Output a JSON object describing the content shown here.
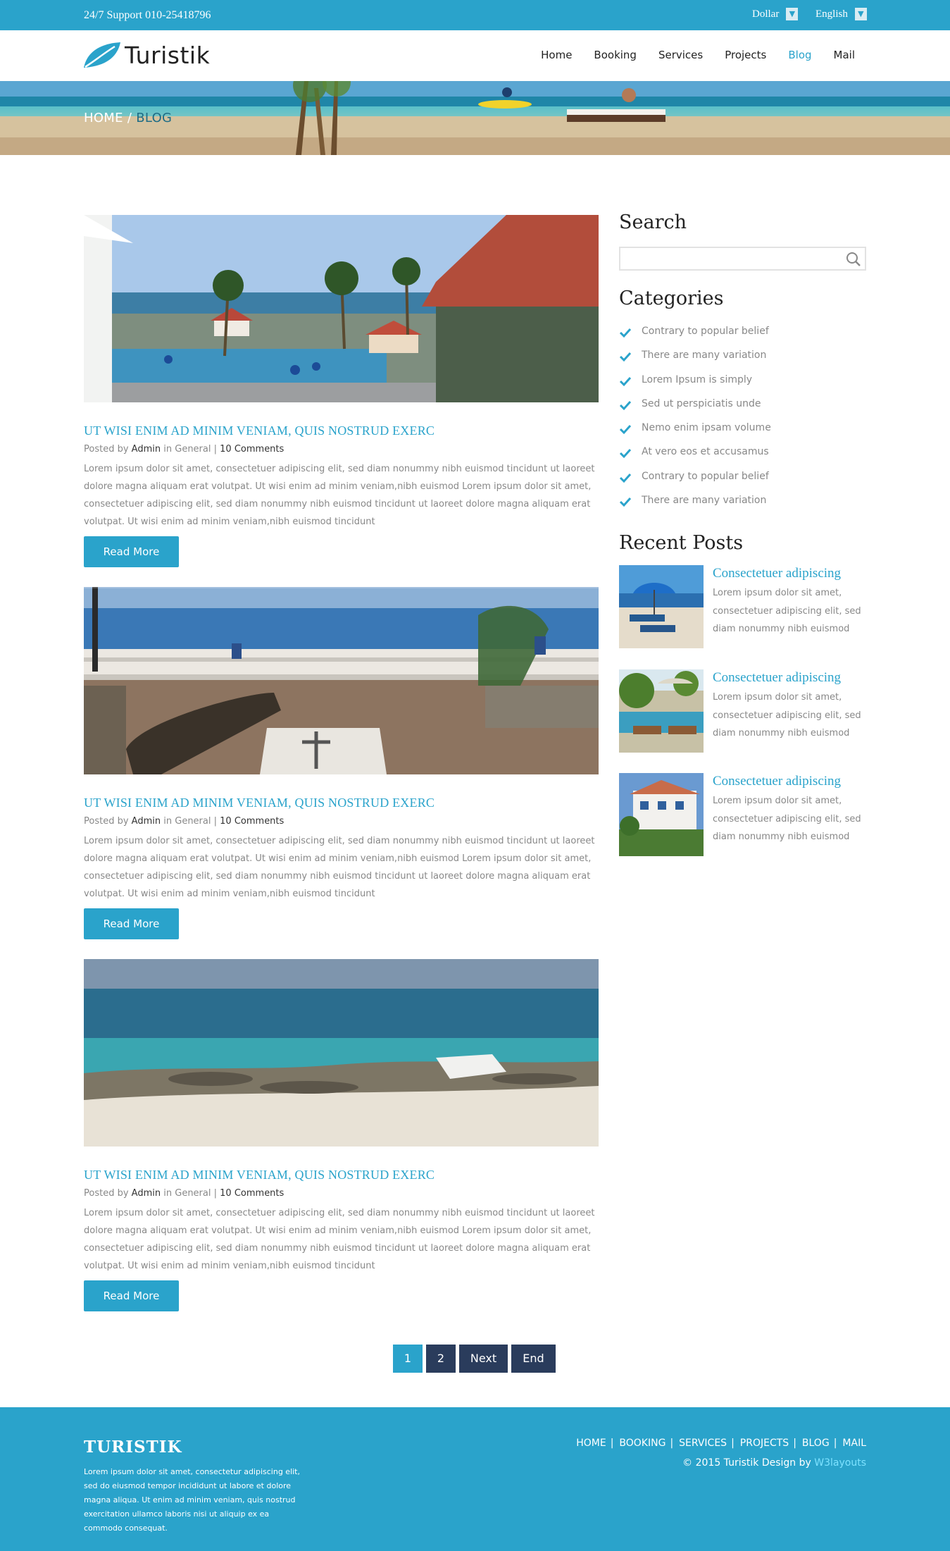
{
  "topbar": {
    "support": "24/7 Support 010-25418796",
    "currency": "Dollar",
    "language": "English"
  },
  "header": {
    "brand": "Turistik",
    "nav": [
      {
        "label": "Home"
      },
      {
        "label": "Booking"
      },
      {
        "label": "Services"
      },
      {
        "label": "Projects"
      },
      {
        "label": "Blog",
        "active": true
      },
      {
        "label": "Mail"
      }
    ]
  },
  "breadcrumb": {
    "home": "HOME",
    "separator": " / ",
    "current": "BLOG"
  },
  "posts": [
    {
      "title": "UT WISI ENIM AD MINIM VENIAM, QUIS NOSTRUD EXERC",
      "posted_by": "Posted by",
      "author": "Admin",
      "in_text": "in",
      "category": "General",
      "divider": "|",
      "comments": "10 Comments",
      "body": "Lorem ipsum dolor sit amet, consectetuer adipiscing elit, sed diam nonummy nibh euismod tincidunt ut laoreet dolore magna aliquam erat volutpat. Ut wisi enim ad minim veniam,nibh euismod Lorem ipsum dolor sit amet, consectetuer adipiscing elit, sed diam nonummy nibh euismod tincidunt ut laoreet dolore magna aliquam erat volutpat. Ut wisi enim ad minim veniam,nibh euismod tincidunt",
      "button": "Read More"
    },
    {
      "title": "UT WISI ENIM AD MINIM VENIAM, QUIS NOSTRUD EXERC",
      "posted_by": "Posted by",
      "author": "Admin",
      "in_text": "in",
      "category": "General",
      "divider": "|",
      "comments": "10 Comments",
      "body": "Lorem ipsum dolor sit amet, consectetuer adipiscing elit, sed diam nonummy nibh euismod tincidunt ut laoreet dolore magna aliquam erat volutpat. Ut wisi enim ad minim veniam,nibh euismod Lorem ipsum dolor sit amet, consectetuer adipiscing elit, sed diam nonummy nibh euismod tincidunt ut laoreet dolore magna aliquam erat volutpat. Ut wisi enim ad minim veniam,nibh euismod tincidunt",
      "button": "Read More"
    },
    {
      "title": "UT WISI ENIM AD MINIM VENIAM, QUIS NOSTRUD EXERC",
      "posted_by": "Posted by",
      "author": "Admin",
      "in_text": "in",
      "category": "General",
      "divider": "|",
      "comments": "10 Comments",
      "body": "Lorem ipsum dolor sit amet, consectetuer adipiscing elit, sed diam nonummy nibh euismod tincidunt ut laoreet dolore magna aliquam erat volutpat. Ut wisi enim ad minim veniam,nibh euismod Lorem ipsum dolor sit amet, consectetuer adipiscing elit, sed diam nonummy nibh euismod tincidunt ut laoreet dolore magna aliquam erat volutpat. Ut wisi enim ad minim veniam,nibh euismod tincidunt",
      "button": "Read More"
    }
  ],
  "sidebar": {
    "search_title": "Search",
    "search_value": "",
    "categories_title": "Categories",
    "categories": [
      "Contrary to popular belief",
      "There are many variation",
      "Lorem Ipsum is simply",
      "Sed ut perspiciatis unde",
      "Nemo enim ipsam volume",
      "At vero eos et accusamus",
      "Contrary to popular belief",
      "There are many variation"
    ],
    "recent_title": "Recent Posts",
    "recent": [
      {
        "title": "Consectetuer adipiscing",
        "text": "Lorem ipsum dolor sit amet, consectetuer adipiscing elit, sed diam nonummy nibh euismod"
      },
      {
        "title": "Consectetuer adipiscing",
        "text": "Lorem ipsum dolor sit amet, consectetuer adipiscing elit, sed diam nonummy nibh euismod"
      },
      {
        "title": "Consectetuer adipiscing",
        "text": "Lorem ipsum dolor sit amet, consectetuer adipiscing elit, sed diam nonummy nibh euismod"
      }
    ]
  },
  "pagination": {
    "pages": [
      "1",
      "2"
    ],
    "current": "1",
    "next": "Next",
    "end": "End"
  },
  "footer": {
    "title": "TURISTIK",
    "text": "Lorem ipsum dolor sit amet, consectetur adipiscing elit, sed do eiusmod tempor incididunt ut labore et dolore magna aliqua. Ut enim ad minim veniam, quis nostrud exercitation ullamco laboris nisi ut aliquip ex ea commodo consequat.",
    "nav": [
      "HOME",
      "BOOKING",
      "SERVICES",
      "PROJECTS",
      "BLOG",
      "MAIL"
    ],
    "nav_divider": "|",
    "copyright": "© 2015 Turistik Design by",
    "copyright_link": "W3layouts"
  },
  "colors": {
    "accent": "#2aa3cb",
    "pager_dark": "#2a3c5c",
    "heading": "#222222",
    "body_text": "#888888"
  },
  "icons": [
    "chevron-down-icon",
    "leaf-logo-icon",
    "search-icon",
    "check-icon"
  ]
}
